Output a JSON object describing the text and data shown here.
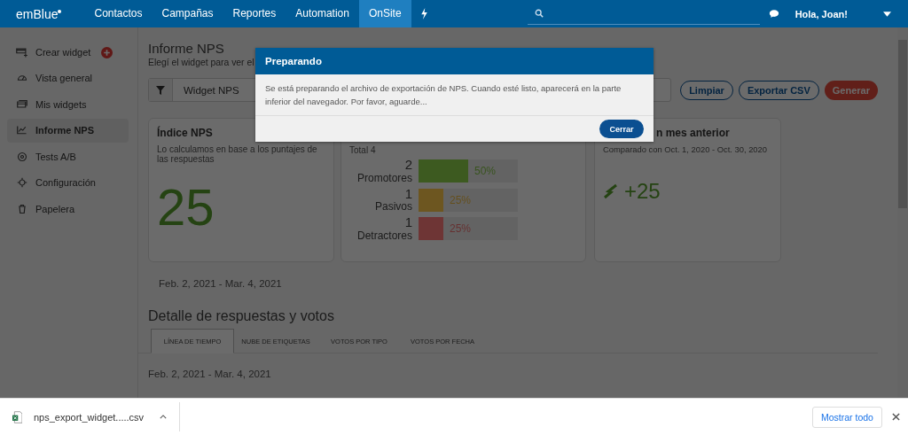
{
  "nav": {
    "logo": "emBlue",
    "items": [
      {
        "label": "Contactos",
        "selected": false
      },
      {
        "label": "Campañas",
        "selected": false
      },
      {
        "label": "Reportes",
        "selected": false
      },
      {
        "label": "Automation",
        "selected": false
      },
      {
        "label": "OnSite",
        "selected": true
      }
    ],
    "greeting": "Hola, Joan!"
  },
  "sidebar": {
    "create": "Crear widget",
    "items": [
      {
        "label": "Vista general",
        "selected": false
      },
      {
        "label": "Mis widgets",
        "selected": false
      },
      {
        "label": "Informe NPS",
        "selected": true
      },
      {
        "label": "Tests A/B",
        "selected": false
      },
      {
        "label": "Configuración",
        "selected": false
      },
      {
        "label": "Papelera",
        "selected": false
      }
    ]
  },
  "page": {
    "title": "Informe NPS",
    "subtitle": "Elegí el widget para ver el",
    "filter": {
      "value": "Widget NPS"
    },
    "buttons": [
      {
        "label": "Limpiar",
        "kind": "outline"
      },
      {
        "label": "Exportar CSV",
        "kind": "outline"
      },
      {
        "label": "Generar",
        "kind": "primary"
      }
    ]
  },
  "nps_card": {
    "title": "Índice NPS",
    "description": "Lo calculamos en base a los puntajes de las respuestas",
    "score": "25"
  },
  "votes_card": {
    "total": "Total 4",
    "rows": [
      {
        "count": "2",
        "label": "Promotores",
        "level": 0.5,
        "percent": "50%",
        "color": "#3d5a20"
      },
      {
        "count": "1",
        "label": "Pasivos",
        "level": 0.25,
        "percent": "25%",
        "color": "#6d5620"
      },
      {
        "count": "1",
        "label": "Detractores",
        "level": 0.25,
        "percent": "25%",
        "color": "#6e3535"
      }
    ]
  },
  "compare_card": {
    "title": "n mes anterior",
    "subtitle": "Comparado con Oct. 1, 2020 - Oct. 30, 2020",
    "delta": "+25"
  },
  "date_range": "Feb. 2, 2021 - Mar. 4, 2021",
  "details": {
    "title": "Detalle de respuestas y votos",
    "tabs": [
      {
        "label": "LÍNEA DE TIEMPO",
        "selected": true
      },
      {
        "label": "NUBE DE ETIQUETAS",
        "selected": false
      },
      {
        "label": "VOTOS POR TIPO",
        "selected": false
      },
      {
        "label": "VOTOS POR FECHA",
        "selected": false
      }
    ],
    "date_range": "Feb. 2, 2021 - Mar. 4, 2021"
  },
  "dialog": {
    "title": "Preparando",
    "message": "Se está preparando el archivo de exportación de NPS. Cuando esté listo, aparecerá en la parte inferior del navegador. Por favor, aguarde...",
    "button": "Cerrar"
  },
  "download_bar": {
    "file": "nps_export_widget.....csv",
    "show_all": "Mostrar todo"
  }
}
